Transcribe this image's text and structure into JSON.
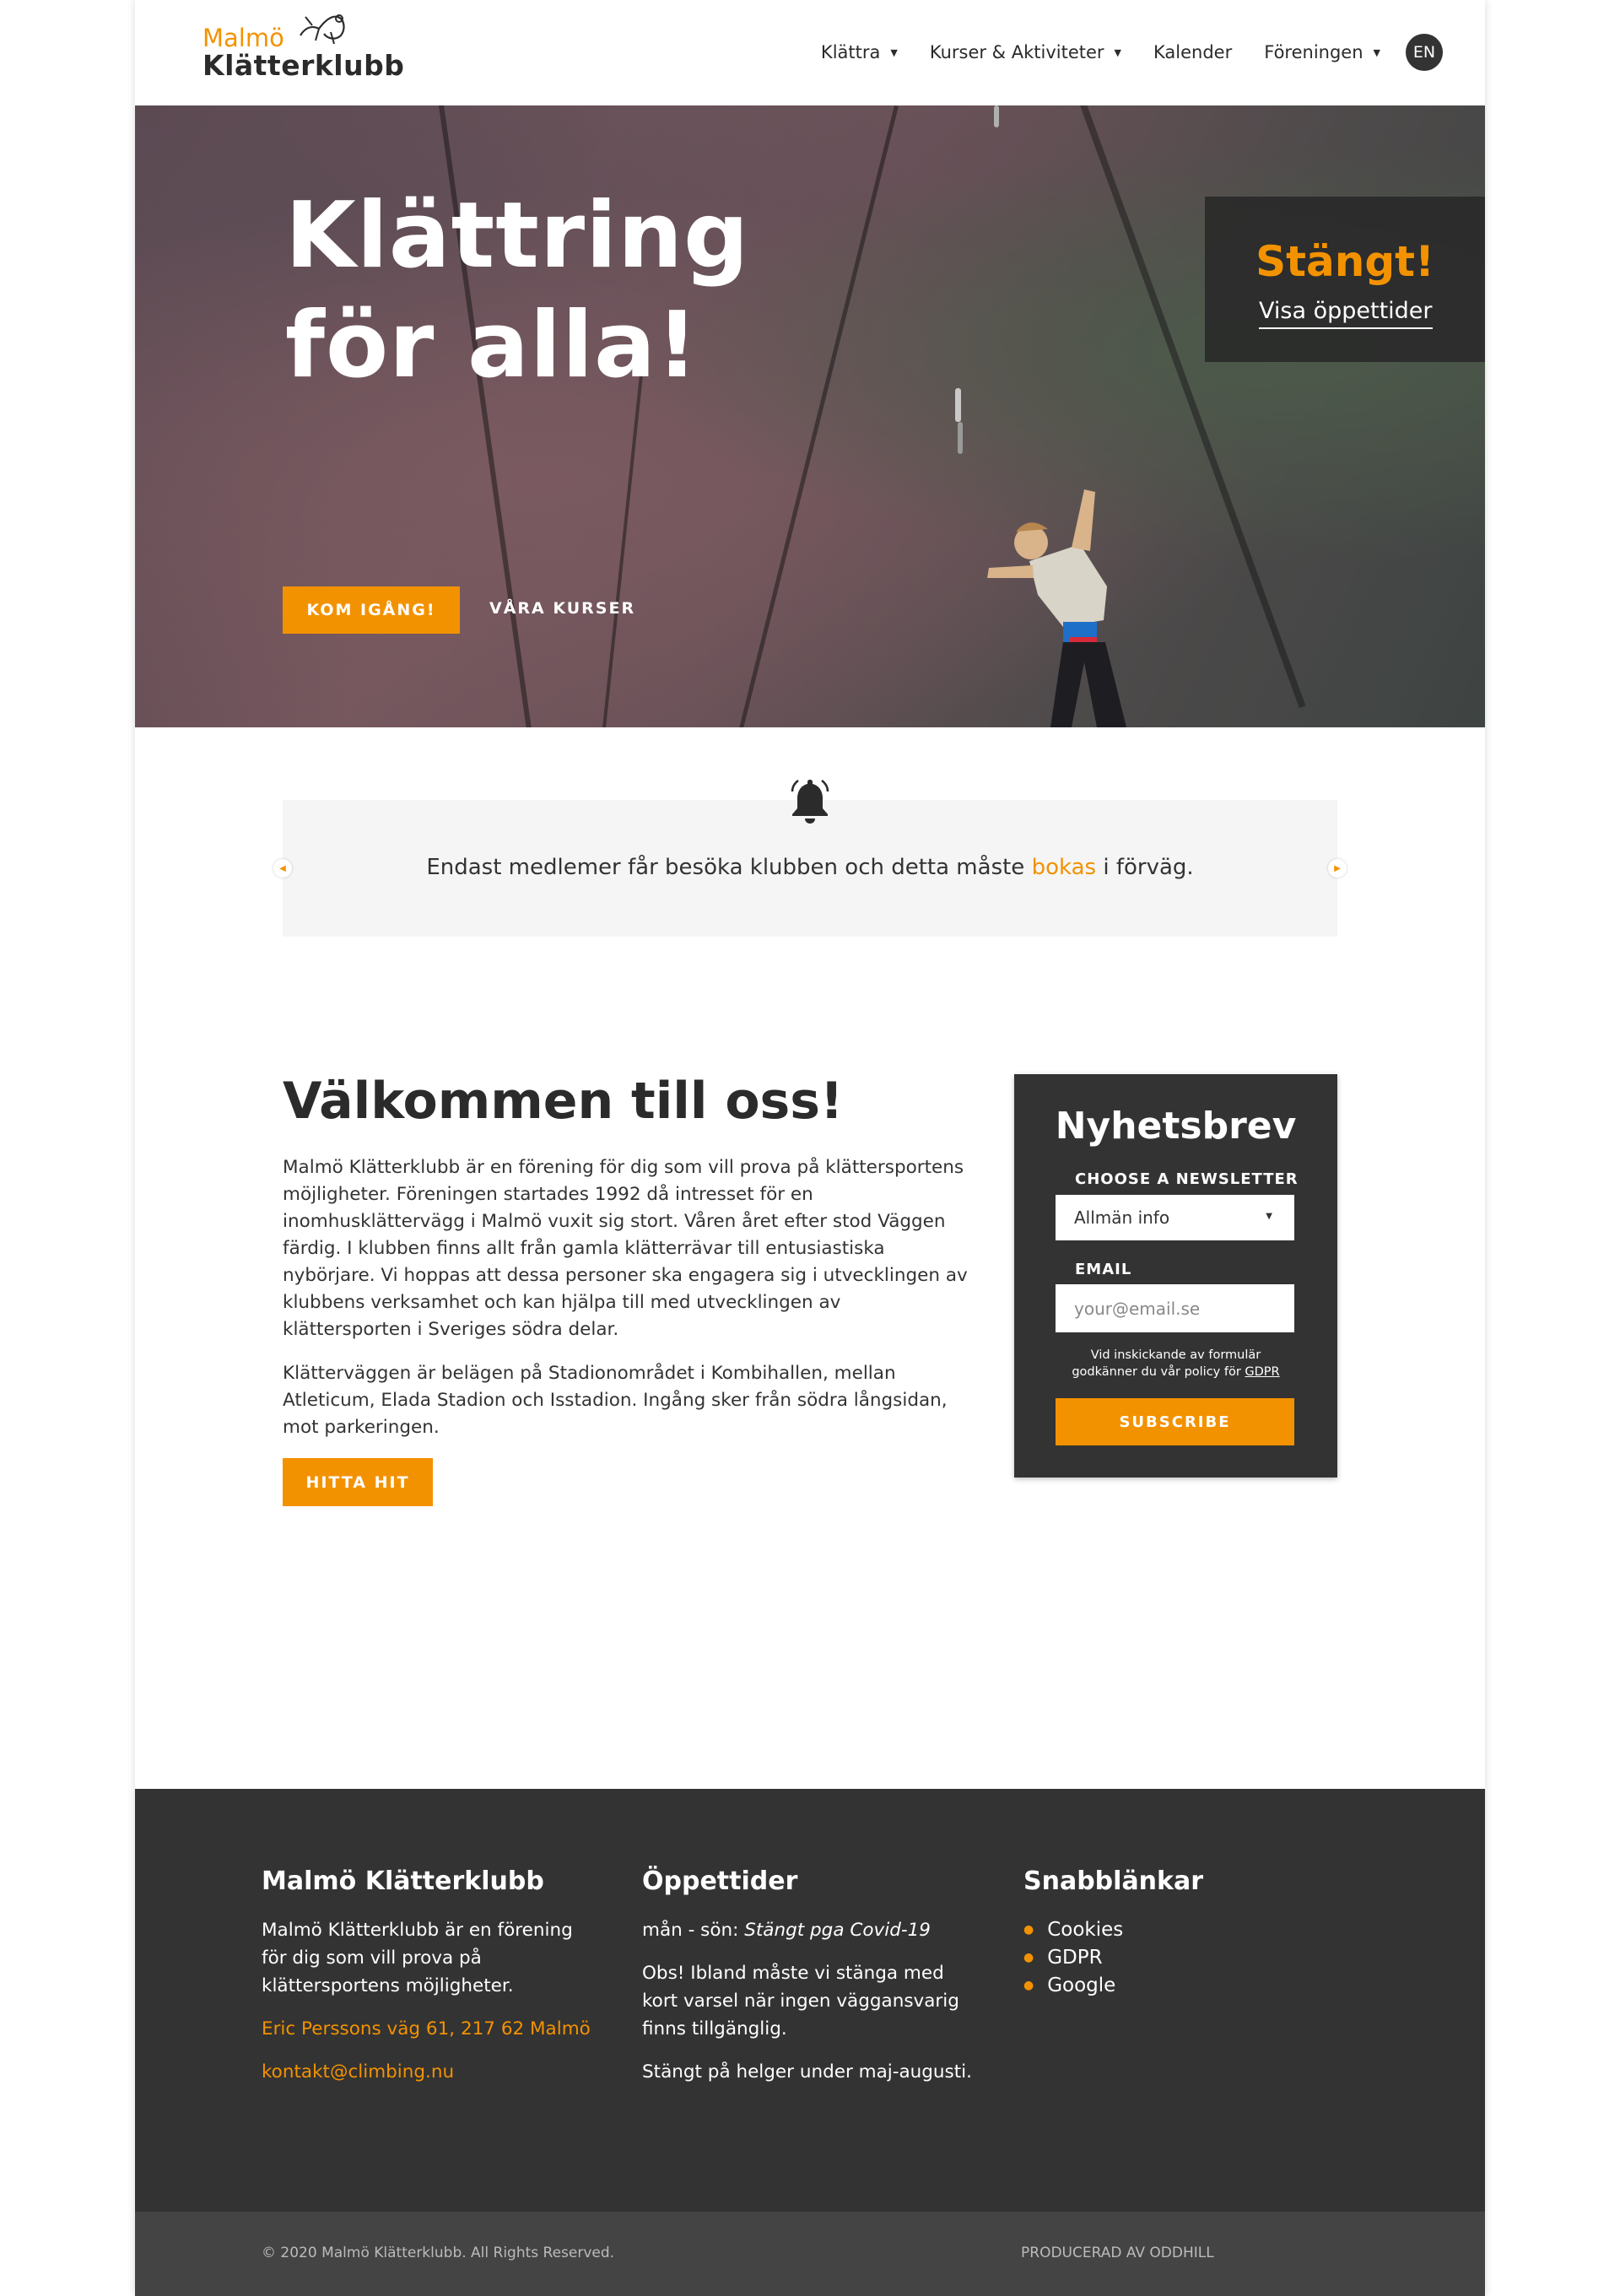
{
  "brand": {
    "logo_line1": "Malmö",
    "logo_line2": "Klätterklubb",
    "accent": "#f39200",
    "dark": "#333333"
  },
  "nav": {
    "items": [
      {
        "label": "Klättra",
        "has_dropdown": true
      },
      {
        "label": "Kurser & Aktiviteter",
        "has_dropdown": true
      },
      {
        "label": "Kalender",
        "has_dropdown": false
      },
      {
        "label": "Föreningen",
        "has_dropdown": true
      }
    ],
    "lang": "EN"
  },
  "hero": {
    "title_line1": "Klättring",
    "title_line2": "för alla!",
    "primary_button": "KOM IGÅNG!",
    "secondary_link": "VÅRA KURSER",
    "status_title": "Stängt!",
    "status_link": "Visa öppettider"
  },
  "notice": {
    "icon": "bell-icon",
    "text_before": "Endast medlemer får besöka klubben och detta måste ",
    "link": "bokas",
    "text_after": " i förväg."
  },
  "welcome": {
    "title": "Välkommen till oss!",
    "paragraph1": "Malmö Klätterklubb är en förening för dig som vill prova på klättersportens möjligheter. Föreningen startades 1992 då intresset för en inomhusklättervägg i Malmö vuxit sig stort. Våren året efter stod Väggen färdig. I klubben finns allt från gamla klätterrävar till entusiastiska nybörjare. Vi hoppas att dessa personer ska engagera sig i utvecklingen av klubbens verksamhet och kan hjälpa till med utvecklingen av klättersporten i Sveriges södra delar.",
    "paragraph2": "Klätterväggen är belägen på Stadionområdet i Kombihallen, mellan Atleticum, Elada Stadion och Isstadion. Ingång sker från södra långsidan, mot parkeringen.",
    "button": "HITTA HIT"
  },
  "newsletter": {
    "title": "Nyhetsbrev",
    "choose_label": "CHOOSE A NEWSLETTER",
    "selected": "Allmän info",
    "email_label": "EMAIL",
    "email_placeholder": "your@email.se",
    "policy_line1": "Vid inskickande av formulär",
    "policy_line2": "godkänner du vår policy för ",
    "policy_link": "GDPR",
    "button": "SUBSCRIBE"
  },
  "footer": {
    "about": {
      "title": "Malmö Klätterklubb",
      "text": "Malmö Klätterklubb är en förening för dig som vill prova på klättersportens möjligheter.",
      "address": "Eric Perssons väg 61, 217 62 Malmö",
      "email": "kontakt@climbing.nu"
    },
    "hours": {
      "title": "Öppettider",
      "days": "mån - sön: ",
      "status": "Stängt pga Covid-19",
      "note": "Obs! Ibland måste vi stänga med kort varsel när ingen väggansvarig finns tillgänglig.",
      "summer": "Stängt på helger under maj-augusti."
    },
    "links": {
      "title": "Snabblänkar",
      "items": [
        "Cookies",
        "GDPR",
        "Google"
      ]
    },
    "copyright": "© 2020 Malmö Klätterklubb. All Rights Reserved.",
    "producer": "PRODUCERAD AV ODDHILL"
  }
}
